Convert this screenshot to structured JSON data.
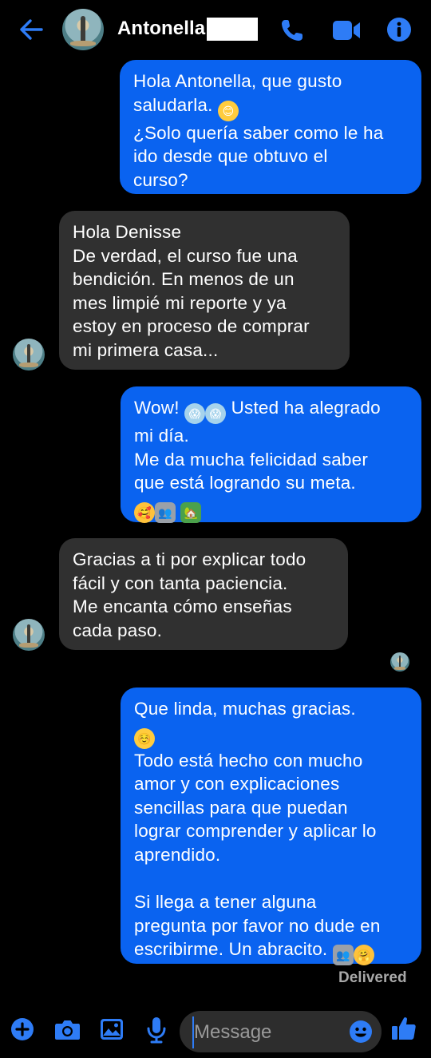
{
  "header": {
    "contact_name": "Antonella",
    "icons": [
      "back-arrow-icon",
      "phone-icon",
      "video-icon",
      "info-icon"
    ]
  },
  "messages": [
    {
      "id": "m1",
      "direction": "outgoing",
      "text": "Hola Antonella, que gusto\nsaludarla.",
      "emoji_after": "😊",
      "text2": "¿Solo quería saber como le ha\nido desde que obtuvo el\ncurso?"
    },
    {
      "id": "m2",
      "direction": "incoming",
      "text": "Hola Denisse\nDe verdad, el curso fue una\nbendición. En menos de un\nmes limpié mi reporte y ya\nestoy en proceso de comprar\nmi primera casa..."
    },
    {
      "id": "m3",
      "direction": "outgoing",
      "line1_prefix": "Wow!",
      "line1_suffix": "Usted ha alegrado",
      "text2": "mi día.\nMe da mucha felicidad saber\nque está logrando su meta.",
      "emojis": [
        "🥰",
        "👥",
        "🏡"
      ]
    },
    {
      "id": "m4",
      "direction": "incoming",
      "text": "Gracias a ti por explicar todo\nfácil y con tanta paciencia.\nMe encanta cómo enseñas\ncada paso."
    },
    {
      "id": "m5",
      "direction": "outgoing",
      "text": "Que linda, muchas gracias.",
      "emoji_line": "☺️",
      "text2": "Todo está hecho con mucho\namor y con explicaciones\nsencillas para que puedan\nlograr comprender y aplicar lo\naprendido.\n\nSi llega a tener alguna\npregunta por favor no dude en\nescribirme. Un abracito."
    }
  ],
  "status": {
    "delivered": "Delivered"
  },
  "composer": {
    "placeholder": "Message",
    "icons": [
      "add-icon",
      "camera-icon",
      "gallery-icon",
      "microphone-icon",
      "emoji-icon",
      "thumbs-up-icon"
    ]
  },
  "colors": {
    "accent": "#0a63f0",
    "incoming_bubble": "#303030",
    "background": "#000000"
  }
}
